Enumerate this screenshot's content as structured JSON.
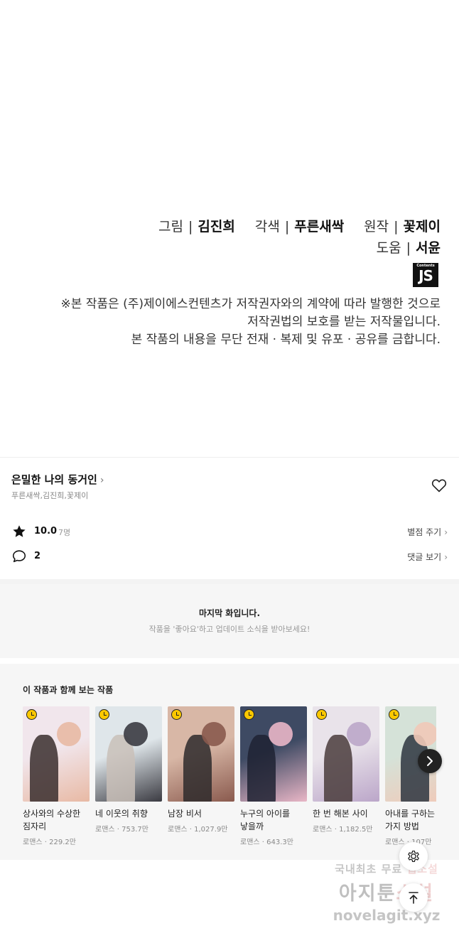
{
  "comic_credits": {
    "line1": [
      {
        "role": "그림",
        "name": "김진희"
      },
      {
        "role": "각색",
        "name": "푸른새싹"
      },
      {
        "role": "원작",
        "name": "꽃제이"
      }
    ],
    "line2": [
      {
        "role": "도움",
        "name": "서윤"
      }
    ],
    "separator": "|",
    "logo_text": "JS",
    "logo_small_text": "Contents",
    "notice": [
      "※본 작품은 (주)제이에스컨텐츠가 저작권자와의 계약에 따라 발행한 것으로",
      "저작권법의 보호를 받는 저작물입니다.",
      "본 작품의 내용을 무단 전재 · 복제 및 유포 · 공유를 금합니다."
    ]
  },
  "series": {
    "title": "은밀한 나의 동거인",
    "title_chevron": "›",
    "authors": "푸른새싹,김진희,꽃제이",
    "rating": "10.0",
    "rating_count": "7명",
    "rate_link": "별점 주기",
    "comments": "2",
    "comment_link": "댓글 보기",
    "link_chevron": "›",
    "icons": [
      "heart-icon",
      "star-icon",
      "comment-icon"
    ]
  },
  "last_episode": {
    "title": "마지막 화입니다.",
    "subtitle": "작품을 '좋아요'하고 업데이트 소식을 받아보세요!"
  },
  "recommendations": {
    "title": "이 작품과 함께 보는 작품",
    "items": [
      {
        "name": "상사와의 수상한 짐자리",
        "meta": "로맨스 · 229.2만",
        "colors": [
          "#f1e6ec",
          "#e8b9a4",
          "#3a2e2e"
        ]
      },
      {
        "name": "네 이웃의 취향",
        "meta": "로맨스 · 753.7만",
        "colors": [
          "#dfe6ea",
          "#3b3b42",
          "#c9c0b8"
        ]
      },
      {
        "name": "남장 비서",
        "meta": "로맨스 · 1,027.9만",
        "colors": [
          "#d8b7a6",
          "#8a5a4e",
          "#2e2a2c"
        ]
      },
      {
        "name": "누구의 아이를 낳을까",
        "meta": "로맨스 · 643.3만",
        "colors": [
          "#3e4a63",
          "#e9b6c6",
          "#1f2233"
        ]
      },
      {
        "name": "한 번 해본 사이",
        "meta": "로맨스 · 1,182.5만",
        "colors": [
          "#e9e3ea",
          "#bba6c9",
          "#4a3c3c"
        ]
      },
      {
        "name": "아내를 구하는 가지 방법",
        "meta": "로맨스 · 107만",
        "colors": [
          "#d5e2d8",
          "#f1c9b8",
          "#2d3540"
        ]
      }
    ]
  },
  "watermark": {
    "line1a": "국내최초 무료",
    "line1b": "웹소설",
    "line2a": "아지툰",
    "line2b": "소설",
    "line3": "novelagit.xyz"
  },
  "icons": [
    "clock-icon",
    "chevron-right-icon",
    "gear-icon",
    "arrow-up-icon"
  ]
}
